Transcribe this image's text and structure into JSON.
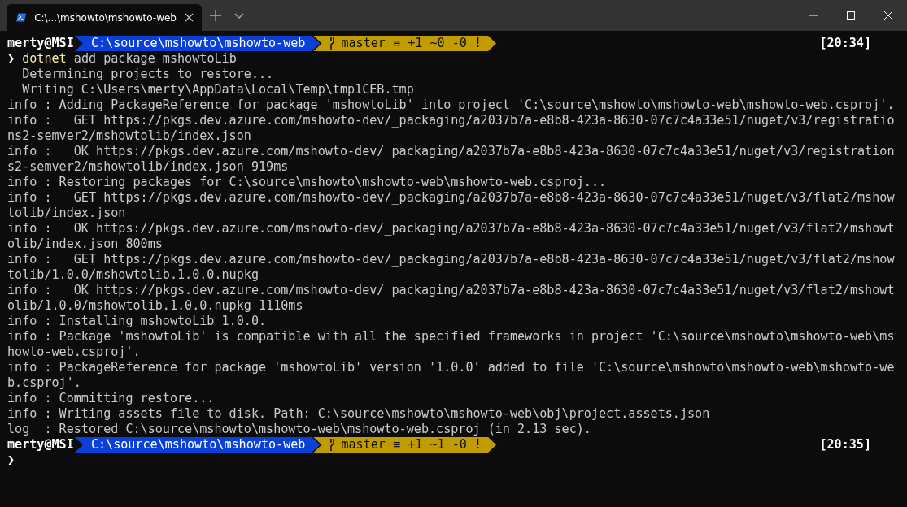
{
  "tab": {
    "title": "C:\\...\\mshowto\\mshowto-web",
    "selected": true
  },
  "lines": [
    {
      "kind": "prompt",
      "user": "merty@MSI",
      "path": "C:\\source\\mshowto\\mshowto-web",
      "branch": "master ≡ +1 ~0 -0 !",
      "time": "[20:34]"
    },
    {
      "kind": "command",
      "chevron": "❯",
      "program": "dotnet",
      "args": "add package mshowtoLib"
    },
    {
      "kind": "output",
      "text": "  Determining projects to restore..."
    },
    {
      "kind": "output",
      "text": "  Writing C:\\Users\\merty\\AppData\\Local\\Temp\\tmp1CEB.tmp"
    },
    {
      "kind": "output",
      "text": "info : Adding PackageReference for package 'mshowtoLib' into project 'C:\\source\\mshowto\\mshowto-web\\mshowto-web.csproj'."
    },
    {
      "kind": "output",
      "text": "info :   GET https://pkgs.dev.azure.com/mshowto-dev/_packaging/a2037b7a-e8b8-423a-8630-07c7c4a33e51/nuget/v3/registratio"
    },
    {
      "kind": "output",
      "text": "ns2-semver2/mshowtolib/index.json"
    },
    {
      "kind": "output",
      "text": "info :   OK https://pkgs.dev.azure.com/mshowto-dev/_packaging/a2037b7a-e8b8-423a-8630-07c7c4a33e51/nuget/v3/registration"
    },
    {
      "kind": "output",
      "text": "s2-semver2/mshowtolib/index.json 919ms"
    },
    {
      "kind": "output",
      "text": "info : Restoring packages for C:\\source\\mshowto\\mshowto-web\\mshowto-web.csproj..."
    },
    {
      "kind": "output",
      "text": "info :   GET https://pkgs.dev.azure.com/mshowto-dev/_packaging/a2037b7a-e8b8-423a-8630-07c7c4a33e51/nuget/v3/flat2/mshow"
    },
    {
      "kind": "output",
      "text": "tolib/index.json"
    },
    {
      "kind": "output",
      "text": "info :   OK https://pkgs.dev.azure.com/mshowto-dev/_packaging/a2037b7a-e8b8-423a-8630-07c7c4a33e51/nuget/v3/flat2/mshowt"
    },
    {
      "kind": "output",
      "text": "olib/index.json 800ms"
    },
    {
      "kind": "output",
      "text": "info :   GET https://pkgs.dev.azure.com/mshowto-dev/_packaging/a2037b7a-e8b8-423a-8630-07c7c4a33e51/nuget/v3/flat2/mshow"
    },
    {
      "kind": "output",
      "text": "tolib/1.0.0/mshowtolib.1.0.0.nupkg"
    },
    {
      "kind": "output",
      "text": "info :   OK https://pkgs.dev.azure.com/mshowto-dev/_packaging/a2037b7a-e8b8-423a-8630-07c7c4a33e51/nuget/v3/flat2/mshowt"
    },
    {
      "kind": "output",
      "text": "olib/1.0.0/mshowtolib.1.0.0.nupkg 1110ms"
    },
    {
      "kind": "output",
      "text": "info : Installing mshowtoLib 1.0.0."
    },
    {
      "kind": "output",
      "text": "info : Package 'mshowtoLib' is compatible with all the specified frameworks in project 'C:\\source\\mshowto\\mshowto-web\\ms"
    },
    {
      "kind": "output",
      "text": "howto-web.csproj'."
    },
    {
      "kind": "output",
      "text": "info : PackageReference for package 'mshowtoLib' version '1.0.0' added to file 'C:\\source\\mshowto\\mshowto-web\\mshowto-we"
    },
    {
      "kind": "output",
      "text": "b.csproj'."
    },
    {
      "kind": "output",
      "text": "info : Committing restore..."
    },
    {
      "kind": "output",
      "text": "info : Writing assets file to disk. Path: C:\\source\\mshowto\\mshowto-web\\obj\\project.assets.json"
    },
    {
      "kind": "output",
      "text": "log  : Restored C:\\source\\mshowto\\mshowto-web\\mshowto-web.csproj (in 2.13 sec)."
    },
    {
      "kind": "prompt",
      "user": "merty@MSI",
      "path": "C:\\source\\mshowto\\mshowto-web",
      "branch": "master ≡ +1 ~1 -0 !",
      "time": "[20:35]"
    },
    {
      "kind": "cursor",
      "chevron": "❯"
    }
  ]
}
